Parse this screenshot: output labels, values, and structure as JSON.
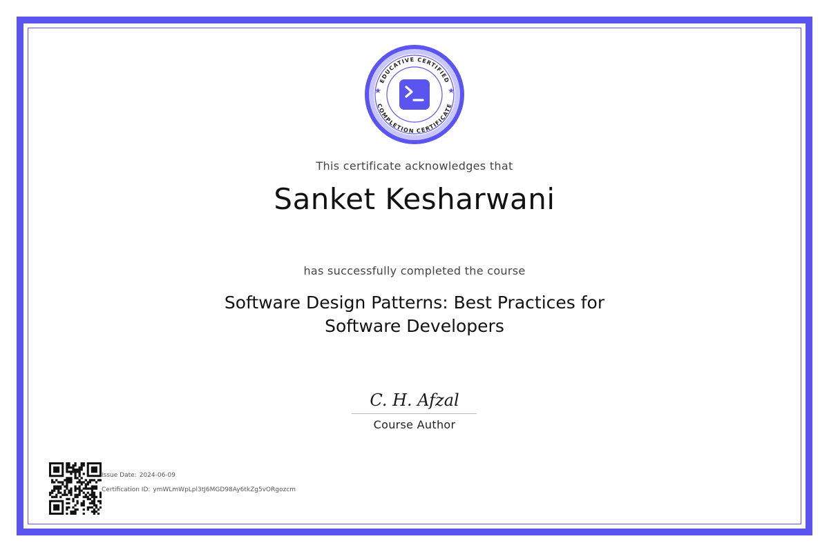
{
  "seal": {
    "top_text": "EDUCATIVE CERTIFIED",
    "bottom_text": "COMPLETION CERTIFICATE",
    "icon": "terminal-prompt-icon",
    "color": "#5b55f0"
  },
  "acknowledgement": "This certificate acknowledges that",
  "recipient_name": "Sanket Kesharwani",
  "completion_text": "has successfully completed the course",
  "course_title": "Software Design Patterns:  Best Practices for\nSoftware Developers",
  "signature": {
    "signer": "C. H. Afzal",
    "role": "Course Author"
  },
  "issue": {
    "date_label": "Issue Date:",
    "date": "2024-06-09",
    "id_label": "Certification ID:",
    "id": "ymWLmWpLpl3tJ6MGD98Ay6tkZg5vORgozcm"
  },
  "colors": {
    "accent": "#5b55f0",
    "text": "#111111",
    "muted": "#444444"
  }
}
